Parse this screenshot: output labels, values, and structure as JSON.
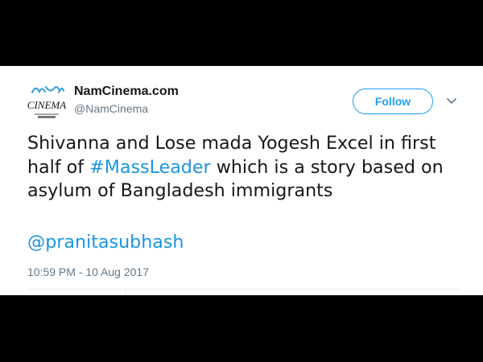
{
  "account": {
    "display_name": "NamCinema.com",
    "handle": "@NamCinema",
    "avatar_icon": "namcinema-logo-icon",
    "avatar_text": "CINEMA"
  },
  "follow_button": {
    "label": "Follow"
  },
  "menu": {
    "icon": "chevron-down-icon"
  },
  "tweet": {
    "line1": "Shivanna and Lose mada Yogesh Excel in first",
    "line2_before": "half of ",
    "hashtag": "#MassLeader",
    "line2_after": " which is a story based on",
    "line3": "asylum of Bangladesh immigrants",
    "mention": "@pranitasubhash"
  },
  "timestamp": "10:59 PM - 10 Aug 2017",
  "colors": {
    "accent": "#1da1f2",
    "link": "#1b95e0",
    "text": "#14171a",
    "secondary": "#657786",
    "letterbox": "#000000"
  }
}
